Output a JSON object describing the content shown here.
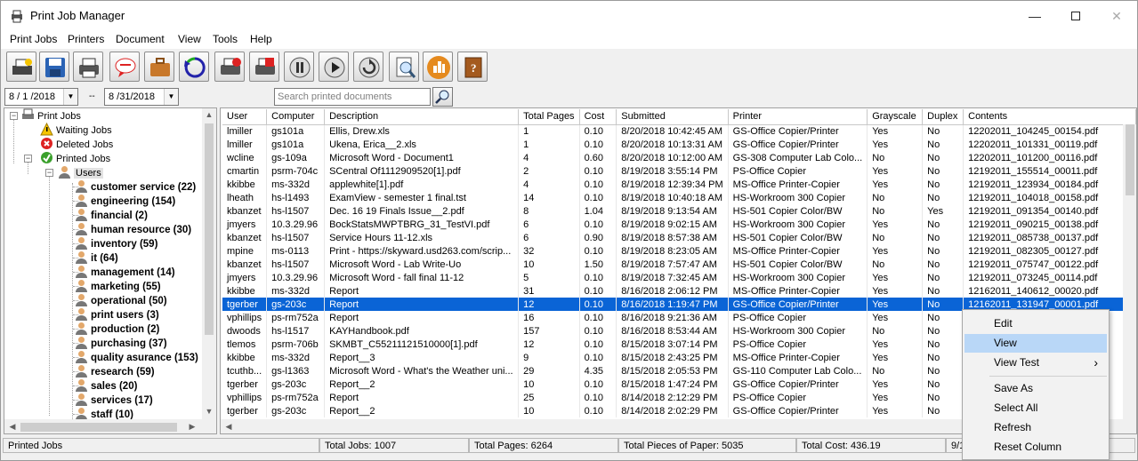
{
  "window": {
    "title": "Print Job Manager"
  },
  "menu": [
    "Print Jobs",
    "Printers",
    "Document",
    "View",
    "Tools",
    "Help"
  ],
  "toolbar_icons": [
    "print-settings-icon",
    "save-icon",
    "printer-icon",
    "message-icon",
    "briefcase-icon",
    "refresh-icon",
    "delete-printer-icon",
    "stop-printer-icon",
    "pause-icon",
    "play-icon",
    "restart-icon",
    "preview-icon",
    "chart-icon",
    "book-icon"
  ],
  "filter": {
    "date_from": "8 / 1 /2018",
    "separator": "--",
    "date_to": "8 /31/2018",
    "search_placeholder": "Search printed documents"
  },
  "tree": {
    "root": "Print Jobs",
    "waiting": "Waiting Jobs",
    "deleted": "Deleted Jobs",
    "printed": "Printed Jobs",
    "users": "Users",
    "groups": [
      "customer service (22)",
      "engineering (154)",
      "financial (2)",
      "human resource (30)",
      "inventory (59)",
      "it (64)",
      "management (14)",
      "marketing (55)",
      "operational (50)",
      "print users (3)",
      "production (2)",
      "purchasing (37)",
      "quality asurance (153)",
      "research (59)",
      "sales (20)",
      "services (17)",
      "staff (10)"
    ]
  },
  "table": {
    "columns": [
      "User",
      "Computer",
      "Description",
      "Total Pages",
      "Cost",
      "Submitted",
      "Printer",
      "Grayscale",
      "Duplex",
      "Contents"
    ],
    "rows": [
      [
        "lmiller",
        "gs101a",
        "Ellis, Drew.xls",
        "1",
        "0.10",
        "8/20/2018 10:42:45 AM",
        "GS-Office Copier/Printer",
        "Yes",
        "No",
        "12202011_104245_00154.pdf"
      ],
      [
        "lmiller",
        "gs101a",
        "Ukena, Erica__2.xls",
        "1",
        "0.10",
        "8/20/2018 10:13:31 AM",
        "GS-Office Copier/Printer",
        "Yes",
        "No",
        "12202011_101331_00119.pdf"
      ],
      [
        "wcline",
        "gs-109a",
        "Microsoft Word - Document1",
        "4",
        "0.60",
        "8/20/2018 10:12:00 AM",
        "GS-308 Computer Lab Colo...",
        "No",
        "No",
        "12202011_101200_00116.pdf"
      ],
      [
        "cmartin",
        "psrm-704c",
        "SCentral Of1112909520[1].pdf",
        "2",
        "0.10",
        "8/19/2018 3:55:14 PM",
        "PS-Office Copier",
        "Yes",
        "No",
        "12192011_155514_00011.pdf"
      ],
      [
        "kkibbe",
        "ms-332d",
        "applewhite[1].pdf",
        "4",
        "0.10",
        "8/19/2018 12:39:34 PM",
        "MS-Office Printer-Copier",
        "Yes",
        "No",
        "12192011_123934_00184.pdf"
      ],
      [
        "lheath",
        "hs-l1493",
        "ExamView - semester 1 final.tst",
        "14",
        "0.10",
        "8/19/2018 10:40:18 AM",
        "HS-Workroom 300 Copier",
        "No",
        "No",
        "12192011_104018_00158.pdf"
      ],
      [
        "kbanzet",
        "hs-l1507",
        "Dec. 16  19 Finals Issue__2.pdf",
        "8",
        "1.04",
        "8/19/2018 9:13:54 AM",
        "HS-501 Copier Color/BW",
        "No",
        "Yes",
        "12192011_091354_00140.pdf"
      ],
      [
        "jmyers",
        "10.3.29.96",
        "BockStatsMWPTBRG_31_TestVI.pdf",
        "6",
        "0.10",
        "8/19/2018 9:02:15 AM",
        "HS-Workroom 300 Copier",
        "Yes",
        "No",
        "12192011_090215_00138.pdf"
      ],
      [
        "kbanzet",
        "hs-l1507",
        "Service Hours 11-12.xls",
        "6",
        "0.90",
        "8/19/2018 8:57:38 AM",
        "HS-501 Copier Color/BW",
        "No",
        "No",
        "12192011_085738_00137.pdf"
      ],
      [
        "mpine",
        "ms-0113",
        "Print - https://skyward.usd263.com/scrip...",
        "32",
        "0.10",
        "8/19/2018 8:23:05 AM",
        "MS-Office Printer-Copier",
        "Yes",
        "No",
        "12192011_082305_00127.pdf"
      ],
      [
        "kbanzet",
        "hs-l1507",
        "Microsoft Word - Lab Write-Uo",
        "10",
        "1.50",
        "8/19/2018 7:57:47 AM",
        "HS-501 Copier Color/BW",
        "No",
        "No",
        "12192011_075747_00122.pdf"
      ],
      [
        "jmyers",
        "10.3.29.96",
        "Microsoft Word - fall final 11-12",
        "5",
        "0.10",
        "8/19/2018 7:32:45 AM",
        "HS-Workroom 300 Copier",
        "Yes",
        "No",
        "12192011_073245_00114.pdf"
      ],
      [
        "kkibbe",
        "ms-332d",
        "Report",
        "31",
        "0.10",
        "8/16/2018 2:06:12 PM",
        "MS-Office Printer-Copier",
        "Yes",
        "No",
        "12162011_140612_00020.pdf"
      ],
      [
        "tgerber",
        "gs-203c",
        "Report",
        "12",
        "0.10",
        "8/16/2018 1:19:47 PM",
        "GS-Office Copier/Printer",
        "Yes",
        "No",
        "12162011_131947_00001.pdf"
      ],
      [
        "vphillips",
        "ps-rm752a",
        "Report",
        "16",
        "0.10",
        "8/16/2018 9:21:36 AM",
        "PS-Office Copier",
        "Yes",
        "No",
        ""
      ],
      [
        "dwoods",
        "hs-l1517",
        "KAYHandbook.pdf",
        "157",
        "0.10",
        "8/16/2018 8:53:44 AM",
        "HS-Workroom 300 Copier",
        "No",
        "No",
        ""
      ],
      [
        "tlemos",
        "psrm-706b",
        "SKMBT_C55211121510000[1].pdf",
        "12",
        "0.10",
        "8/15/2018 3:07:14 PM",
        "PS-Office Copier",
        "Yes",
        "No",
        ""
      ],
      [
        "kkibbe",
        "ms-332d",
        "Report__3",
        "9",
        "0.10",
        "8/15/2018 2:43:25 PM",
        "MS-Office Printer-Copier",
        "Yes",
        "No",
        ""
      ],
      [
        "tcuthb...",
        "gs-l1363",
        "Microsoft Word - What's the Weather uni...",
        "29",
        "4.35",
        "8/15/2018 2:05:53 PM",
        "GS-110 Computer Lab Colo...",
        "No",
        "No",
        ""
      ],
      [
        "tgerber",
        "gs-203c",
        "Report__2",
        "10",
        "0.10",
        "8/15/2018 1:47:24 PM",
        "GS-Office Copier/Printer",
        "Yes",
        "No",
        ""
      ],
      [
        "vphillips",
        "ps-rm752a",
        "Report",
        "25",
        "0.10",
        "8/14/2018 2:12:29 PM",
        "PS-Office Copier",
        "Yes",
        "No",
        ""
      ],
      [
        "tgerber",
        "gs-203c",
        "Report__2",
        "10",
        "0.10",
        "8/14/2018 2:02:29 PM",
        "GS-Office Copier/Printer",
        "Yes",
        "No",
        ""
      ]
    ]
  },
  "status": {
    "left": "Printed Jobs",
    "jobs": "Total Jobs: 1007",
    "pages": "Total Pages: 6264",
    "paper": "Total Pieces of Paper: 5035",
    "cost": "Total Cost: 436.19",
    "extra": "9/1"
  },
  "context_menu": {
    "items": [
      "Edit",
      "View",
      "View Test",
      "Save As",
      "Select All",
      "Refresh",
      "Reset Column"
    ],
    "highlighted": "View",
    "submenu_arrow": "›"
  },
  "colors": {
    "selection": "#0a64d6",
    "highlight": "#b9d7f7"
  }
}
